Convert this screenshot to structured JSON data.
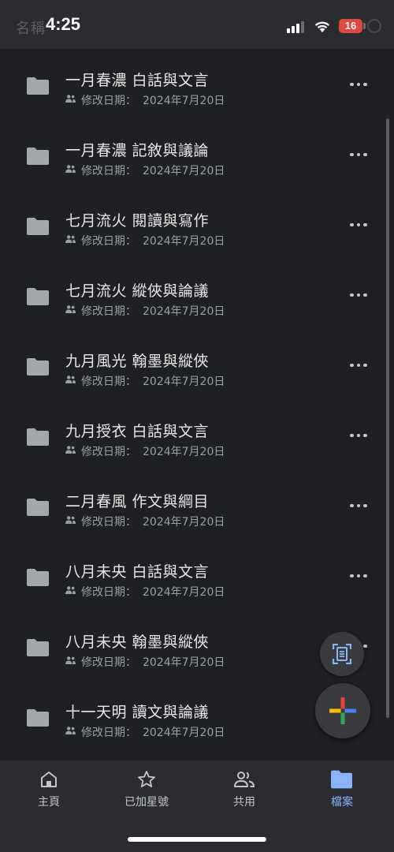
{
  "status_bar": {
    "time": "4:25",
    "battery": "16",
    "header_ghost": "名稱"
  },
  "files": [
    {
      "title": "一月春濃 白話與文言",
      "meta_label": "修改日期：",
      "meta_date": "2024年7月20日"
    },
    {
      "title": "一月春濃 記敘與議論",
      "meta_label": "修改日期：",
      "meta_date": "2024年7月20日"
    },
    {
      "title": "七月流火 閱讀與寫作",
      "meta_label": "修改日期：",
      "meta_date": "2024年7月20日"
    },
    {
      "title": "七月流火 縱俠與論議",
      "meta_label": "修改日期：",
      "meta_date": "2024年7月20日"
    },
    {
      "title": "九月風光 翰墨與縱俠",
      "meta_label": "修改日期：",
      "meta_date": "2024年7月20日"
    },
    {
      "title": "九月授衣 白話與文言",
      "meta_label": "修改日期：",
      "meta_date": "2024年7月20日"
    },
    {
      "title": "二月春風 作文與綱目",
      "meta_label": "修改日期：",
      "meta_date": "2024年7月20日"
    },
    {
      "title": "八月未央 白話與文言",
      "meta_label": "修改日期：",
      "meta_date": "2024年7月20日"
    },
    {
      "title": "八月未央 翰墨與縱俠",
      "meta_label": "修改日期：",
      "meta_date": "2024年7月20日"
    },
    {
      "title": "十一天明 讀文與論議",
      "meta_label": "修改日期：",
      "meta_date": "2024年7月20日"
    }
  ],
  "icons": {
    "folder": "folder-icon",
    "shared": "shared-people-icon",
    "more": "more-horizontal-icon",
    "scan": "document-scan-icon",
    "new": "plus-icon"
  },
  "nav": [
    {
      "label": "主頁",
      "icon": "home-icon",
      "active": false
    },
    {
      "label": "已加星號",
      "icon": "star-icon",
      "active": false
    },
    {
      "label": "共用",
      "icon": "people-icon",
      "active": false
    },
    {
      "label": "檔案",
      "icon": "folder-icon",
      "active": true
    }
  ],
  "colors": {
    "background": "#1f2023",
    "bar_background": "#2b2c30",
    "accent": "#8ab4f8",
    "battery_low": "#e0483f",
    "plus_blue": "#4285f4",
    "plus_red": "#ea4335",
    "plus_yellow": "#fbbc04",
    "plus_green": "#34a853"
  }
}
